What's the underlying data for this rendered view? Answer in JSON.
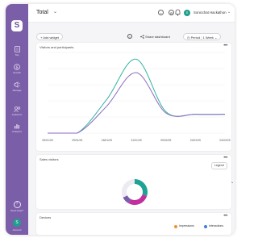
{
  "sidebar": {
    "logo": "S",
    "items": [
      {
        "label": "Tap",
        "icon": "document-icon"
      },
      {
        "label": "Growth",
        "icon": "dollar-icon"
      },
      {
        "label": "Manage",
        "icon": "megaphone-icon"
      },
      {
        "label": "Audience",
        "icon": "users-icon"
      },
      {
        "label": "Analytics",
        "icon": "bar-chart-icon"
      }
    ],
    "help_label": "Need Help?",
    "avatar_initial": "S",
    "avatar_label": "Account"
  },
  "header": {
    "title": "Total",
    "user_initial": "S",
    "user_name": "Sonicchat Hackathon"
  },
  "toolbar": {
    "add_widget": "+  Add widget",
    "share_dashboard": "Share dashboard",
    "period_label": "Period",
    "period_value": "1 Week"
  },
  "visitors_card": {
    "title": "Visitors and participants",
    "x_ticks": [
      "05/01/25",
      "29/01/25",
      "18/01/25",
      "31/01/25",
      "09/02/25",
      "22/02/25",
      "04/03/25"
    ]
  },
  "chart_data": {
    "type": "line",
    "x": [
      "05/01/25",
      "29/01/25",
      "18/01/25",
      "31/01/25",
      "09/02/25",
      "22/02/25",
      "04/03/25"
    ],
    "series": [
      {
        "color": "#35b3a0",
        "values": [
          0,
          0,
          25,
          55,
          16,
          14,
          14
        ]
      },
      {
        "color": "#8a6bc0",
        "values": [
          0,
          0,
          20,
          45,
          15,
          14,
          14
        ]
      }
    ],
    "grid": true,
    "legend": "none"
  },
  "sales_card": {
    "title": "Sales visitors",
    "legend_button": "Legend",
    "donut": [
      {
        "color": "#1fa395",
        "value": 30
      },
      {
        "color": "#c0319d",
        "value": 28
      },
      {
        "color": "#7b5ea8",
        "value": 10
      },
      {
        "color": "#ebebf1",
        "value": 32
      }
    ]
  },
  "devices_card": {
    "title": "Devices",
    "legend": [
      {
        "label": "Impressions",
        "color": "#f0922a"
      },
      {
        "label": "Interactions",
        "color": "#3f7fdc"
      }
    ]
  }
}
